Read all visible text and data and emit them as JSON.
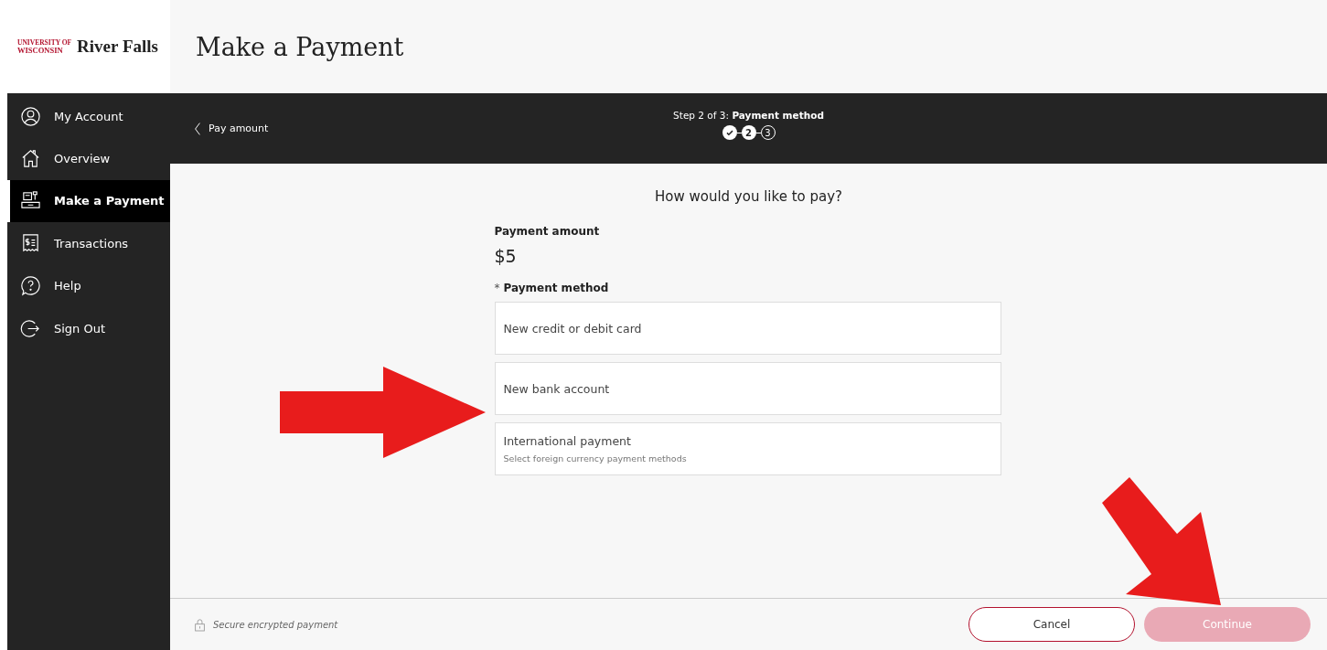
{
  "logo": {
    "line_1": "UNIVERSITY OF",
    "line_2": "WISCONSIN",
    "name": "River Falls"
  },
  "page_title": "Make a Payment",
  "sidebar": {
    "items": [
      {
        "label": "My Account",
        "kind": "person",
        "selected": false
      },
      {
        "label": "Overview",
        "kind": "home",
        "selected": false
      },
      {
        "label": "Make a Payment",
        "kind": "register",
        "selected": true
      },
      {
        "label": "Transactions",
        "kind": "receipt",
        "selected": false
      },
      {
        "label": "Help",
        "kind": "help",
        "selected": false
      },
      {
        "label": "Sign Out",
        "kind": "signout",
        "selected": false
      }
    ]
  },
  "step_bar": {
    "back_link": "Pay amount",
    "step_text": "Step 2 of 3:",
    "step_name": "Payment method",
    "steps": [
      {
        "kind": "done"
      },
      {
        "label": "2",
        "kind": "current"
      },
      {
        "label": "3",
        "kind": "upcoming"
      }
    ]
  },
  "form": {
    "question": "How would you like to pay?",
    "amount_label": "Payment amount",
    "amount": "$5",
    "required_mark": "*",
    "method_label": "Payment method",
    "options": [
      {
        "title": "New credit or debit card",
        "selected": false
      },
      {
        "title": "New bank account",
        "selected": false
      },
      {
        "title": "International payment",
        "subtitle": "Select foreign currency payment methods",
        "selected": false
      }
    ]
  },
  "footer": {
    "secure_text": "Secure encrypted payment",
    "buttons": [
      {
        "label": "Cancel",
        "kind": "secondary",
        "disabled": false
      },
      {
        "label": "Continue",
        "kind": "primary",
        "disabled": true
      }
    ]
  },
  "annotations": [
    {
      "kind": "arrow-right"
    },
    {
      "kind": "arrow-down-right"
    }
  ]
}
